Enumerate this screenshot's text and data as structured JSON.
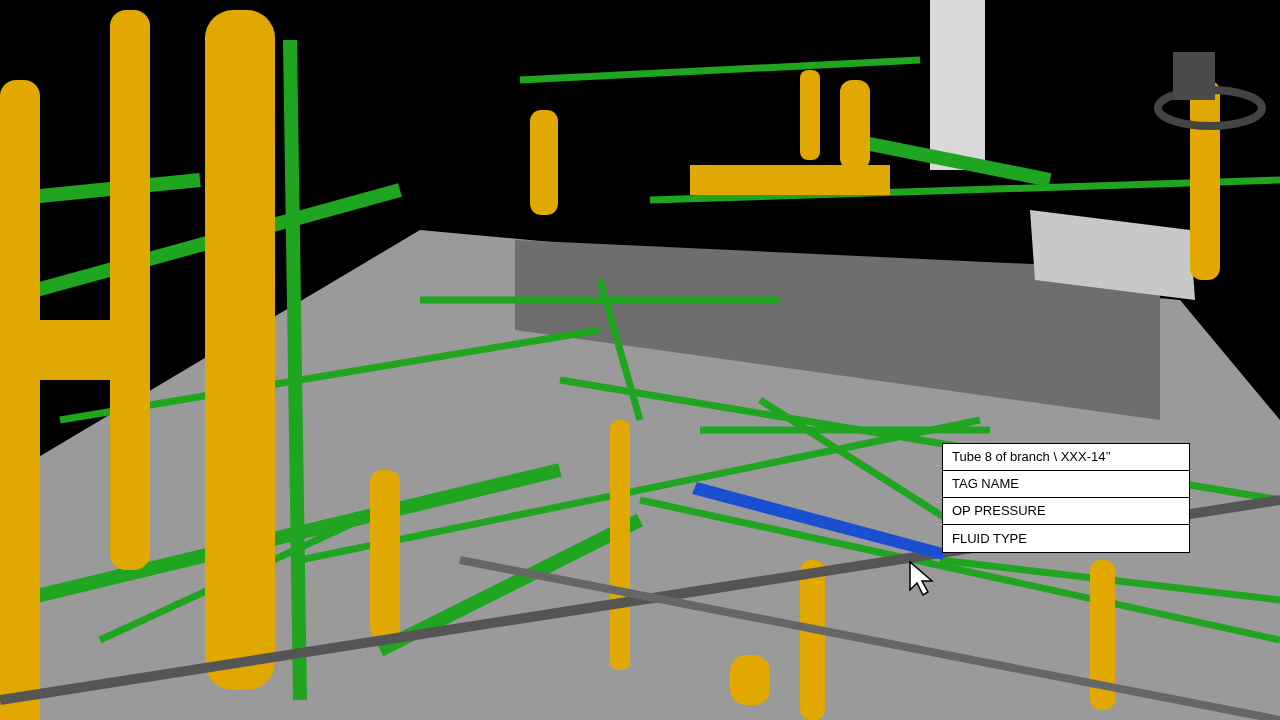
{
  "tooltip": {
    "title": "Tube 8 of branch \\ XXX-14’’",
    "rows": [
      "TAG NAME",
      "OP PRESSURE",
      "FLUID TYPE"
    ]
  }
}
